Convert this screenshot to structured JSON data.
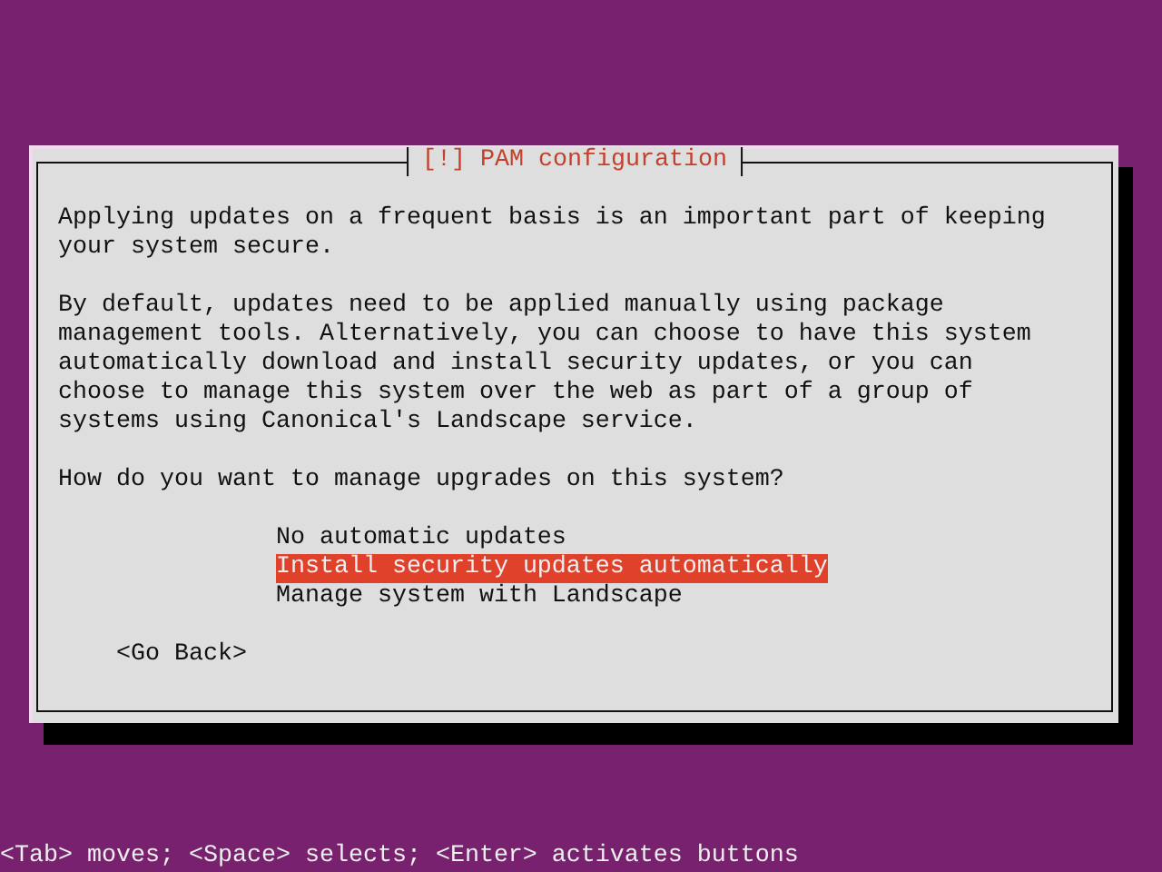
{
  "dialog": {
    "title": "[!] PAM configuration",
    "paragraphs": [
      "Applying updates on a frequent basis is an important part of keeping your system secure.",
      "By default, updates need to be applied manually using package management tools. Alternatively, you can choose to have this system automatically download and install security updates, or you can choose to manage this system over the web as part of a group of systems using Canonical's Landscape service."
    ],
    "question": "How do you want to manage upgrades on this system?",
    "options": [
      {
        "label": "No automatic updates",
        "selected": false
      },
      {
        "label": "Install security updates automatically",
        "selected": true
      },
      {
        "label": "Manage system with Landscape",
        "selected": false
      }
    ],
    "buttons": [
      "<Go Back>"
    ]
  },
  "help_line": "<Tab> moves; <Space> selects; <Enter> activates buttons"
}
